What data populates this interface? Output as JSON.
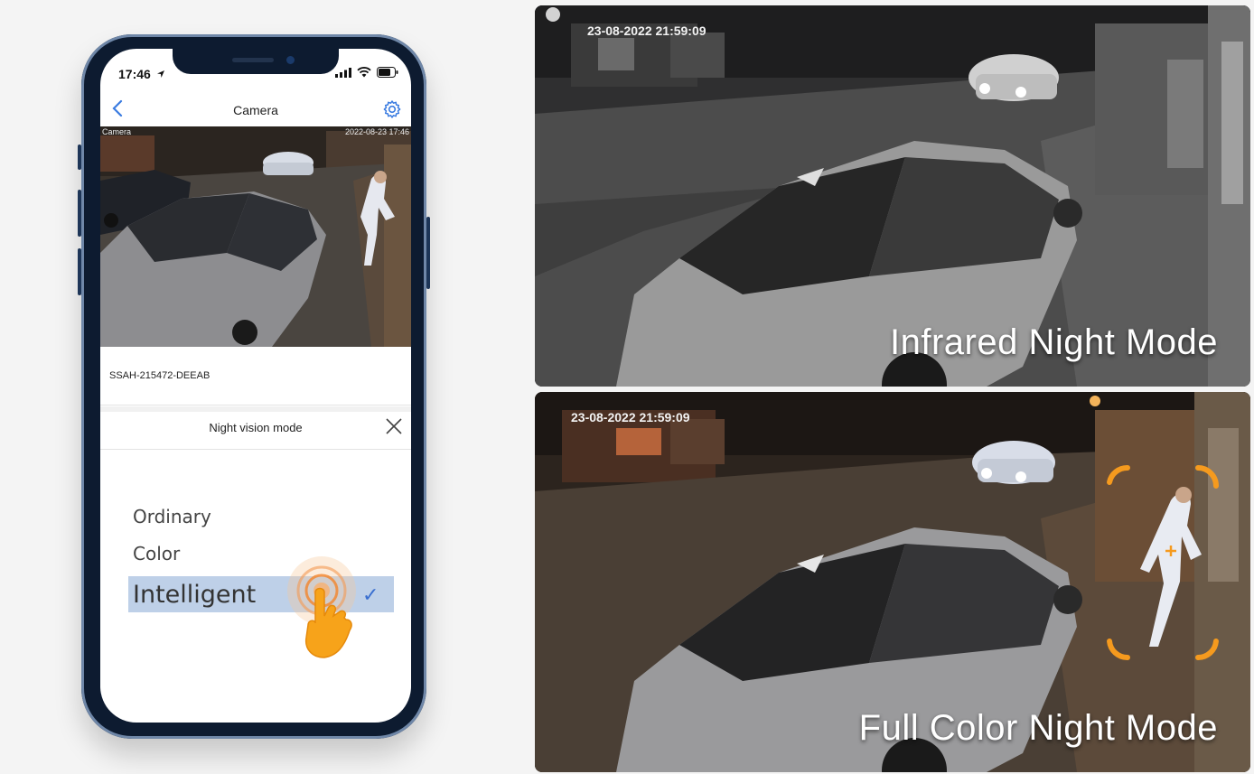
{
  "phone": {
    "status": {
      "time": "17:46"
    },
    "nav": {
      "title": "Camera"
    },
    "feed": {
      "label": "Camera",
      "timestamp": "2022-08-23 17:46"
    },
    "device_id": "SSAH-215472-DEEAB",
    "sheet": {
      "title": "Night vision mode",
      "options": [
        "Ordinary",
        "Color",
        "Intelligent"
      ],
      "selected": "Intelligent"
    }
  },
  "panels": [
    {
      "timestamp": "23-08-2022  21:59:09",
      "mode_label": "Infrared Night Mode"
    },
    {
      "timestamp": "23-08-2022 21:59:09",
      "mode_label": "Full Color Night Mode"
    }
  ],
  "colors": {
    "ios_blue": "#3a7be0",
    "selection": "#bed0e8",
    "detection_orange": "#f59a1e"
  },
  "icons": [
    "location-arrow-icon",
    "signal-icon",
    "wifi-icon",
    "battery-icon",
    "back-chevron-icon",
    "gear-icon",
    "close-icon",
    "tap-hand-icon",
    "checkmark-icon"
  ]
}
